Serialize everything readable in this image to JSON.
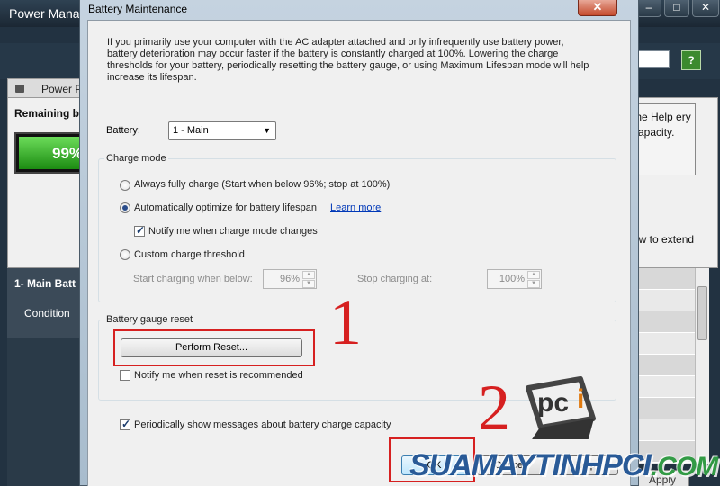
{
  "background_window": {
    "title": "Power Mana",
    "controls": [
      "–",
      "□",
      "✕"
    ],
    "search_text": "c",
    "help_icon": "help-icon",
    "tab_label": "Power P",
    "remaining_label": "Remaining ba",
    "battery_percent_text": "99%",
    "battery_fill_fraction": 0.99,
    "right_text": "the Help ery capacity.",
    "extend_text": "ow to extend",
    "list_battery_name": "1- Main Batt",
    "list_condition": "Condition",
    "apply_label": "Apply"
  },
  "dialog": {
    "title": "Battery Maintenance",
    "close_glyph": "✕",
    "intro": "If you primarily use your computer with the AC adapter attached and only infrequently use battery power, battery deterioration may occur faster if the battery is constantly charged at 100%. Lowering the charge thresholds for your battery, periodically resetting the battery gauge, or using Maximum Lifespan mode will help increase its lifespan.",
    "battery_label": "Battery:",
    "battery_value": "1 - Main",
    "battery_arrow": "▼",
    "charge_mode": {
      "title": "Charge mode",
      "option_full": "Always fully charge (Start when below 96%; stop at 100%)",
      "option_auto": "Automatically optimize for battery lifespan",
      "learn_more": "Learn more",
      "notify_mode": "Notify me when charge mode changes",
      "option_custom": "Custom charge threshold",
      "start_label": "Start charging when below:",
      "start_value": "96%",
      "stop_label": "Stop charging at:",
      "stop_value": "100%",
      "spin_up": "▲",
      "spin_down": "▼"
    },
    "gauge_reset": {
      "title": "Battery gauge reset",
      "button": "Perform Reset...",
      "notify_reset": "Notify me when reset is recommended"
    },
    "periodic_messages": "Periodically show messages about battery charge capacity",
    "buttons": {
      "ok": "OK",
      "cancel": "Cancel",
      "help": "Help"
    }
  },
  "annotations": {
    "step1": "1",
    "step2": "2"
  },
  "watermark": {
    "text": "SUAMAYTINHPCI",
    "suffix": ".COM",
    "logo": "pci"
  },
  "colors": {
    "annotation": "#d62020",
    "link": "#0038b8",
    "dialog_frame": "#b6c7d6"
  }
}
